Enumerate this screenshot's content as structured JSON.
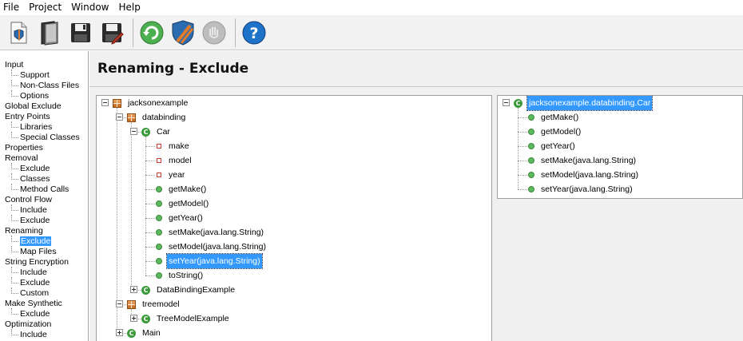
{
  "menu": [
    {
      "label": "File"
    },
    {
      "label": "Project"
    },
    {
      "label": "Window"
    },
    {
      "label": "Help"
    }
  ],
  "toolbar": {
    "buttons": [
      {
        "icon": "new-project-icon"
      },
      {
        "icon": "open-project-icon"
      },
      {
        "icon": "save-icon"
      },
      {
        "icon": "save-as-icon"
      },
      {
        "icon": "refresh-icon"
      },
      {
        "icon": "obfuscate-shield-icon"
      },
      {
        "icon": "stop-icon"
      },
      {
        "icon": "help-icon"
      }
    ]
  },
  "nav": {
    "items": [
      {
        "label": "Input",
        "level": 0
      },
      {
        "label": "Support",
        "level": 1
      },
      {
        "label": "Non-Class Files",
        "level": 1
      },
      {
        "label": "Options",
        "level": 1
      },
      {
        "label": "Global Exclude",
        "level": 0
      },
      {
        "label": "Entry Points",
        "level": 0
      },
      {
        "label": "Libraries",
        "level": 1
      },
      {
        "label": "Special Classes",
        "level": 1
      },
      {
        "label": "Properties",
        "level": 0
      },
      {
        "label": "Removal",
        "level": 0
      },
      {
        "label": "Exclude",
        "level": 1
      },
      {
        "label": "Classes",
        "level": 1
      },
      {
        "label": "Method Calls",
        "level": 1
      },
      {
        "label": "Control Flow",
        "level": 0
      },
      {
        "label": "Include",
        "level": 1
      },
      {
        "label": "Exclude",
        "level": 1
      },
      {
        "label": "Renaming",
        "level": 0
      },
      {
        "label": "Exclude",
        "level": 1,
        "selected": true
      },
      {
        "label": "Map Files",
        "level": 1
      },
      {
        "label": "String Encryption",
        "level": 0
      },
      {
        "label": "Include",
        "level": 1
      },
      {
        "label": "Exclude",
        "level": 1
      },
      {
        "label": "Custom",
        "level": 1
      },
      {
        "label": "Make Synthetic",
        "level": 0
      },
      {
        "label": "Exclude",
        "level": 1
      },
      {
        "label": "Optimization",
        "level": 0
      },
      {
        "label": "Include",
        "level": 1
      }
    ]
  },
  "page": {
    "title": "Renaming - Exclude"
  },
  "left_tree": {
    "nodes": [
      {
        "label": "jacksonexample",
        "type": "package",
        "depth": 0,
        "expander": "minus"
      },
      {
        "label": "databinding",
        "type": "package",
        "depth": 1,
        "expander": "minus"
      },
      {
        "label": "Car",
        "type": "class",
        "depth": 2,
        "expander": "minus"
      },
      {
        "label": "make",
        "type": "field",
        "depth": 3
      },
      {
        "label": "model",
        "type": "field",
        "depth": 3
      },
      {
        "label": "year",
        "type": "field",
        "depth": 3
      },
      {
        "label": "getMake()",
        "type": "method",
        "depth": 3
      },
      {
        "label": "getModel()",
        "type": "method",
        "depth": 3
      },
      {
        "label": "getYear()",
        "type": "method",
        "depth": 3
      },
      {
        "label": "setMake(java.lang.String)",
        "type": "method",
        "depth": 3
      },
      {
        "label": "setModel(java.lang.String)",
        "type": "method",
        "depth": 3
      },
      {
        "label": "setYear(java.lang.String)",
        "type": "method",
        "depth": 3,
        "selected": true
      },
      {
        "label": "toString()",
        "type": "method",
        "depth": 3
      },
      {
        "label": "DataBindingExample",
        "type": "class",
        "depth": 2,
        "expander": "plus"
      },
      {
        "label": "treemodel",
        "type": "package",
        "depth": 1,
        "expander": "minus"
      },
      {
        "label": "TreeModelExample",
        "type": "class",
        "depth": 2,
        "expander": "plus"
      },
      {
        "label": "Main",
        "type": "class",
        "depth": 1,
        "expander": "plus"
      }
    ]
  },
  "right_tree": {
    "nodes": [
      {
        "label": "jacksonexample.databinding.Car",
        "type": "class",
        "depth": 0,
        "expander": "minus",
        "selected": true
      },
      {
        "label": "getMake()",
        "type": "method",
        "depth": 1
      },
      {
        "label": "getModel()",
        "type": "method",
        "depth": 1
      },
      {
        "label": "getYear()",
        "type": "method",
        "depth": 1
      },
      {
        "label": "setMake(java.lang.String)",
        "type": "method",
        "depth": 1
      },
      {
        "label": "setModel(java.lang.String)",
        "type": "method",
        "depth": 1
      },
      {
        "label": "setYear(java.lang.String)",
        "type": "method",
        "depth": 1
      }
    ]
  },
  "colors": {
    "selection": "#3399ff",
    "class_icon": "#3a9a3a",
    "method_icon": "#5cb85c",
    "package_icon": "#c66a1e",
    "field_icon": "#c0392b"
  }
}
